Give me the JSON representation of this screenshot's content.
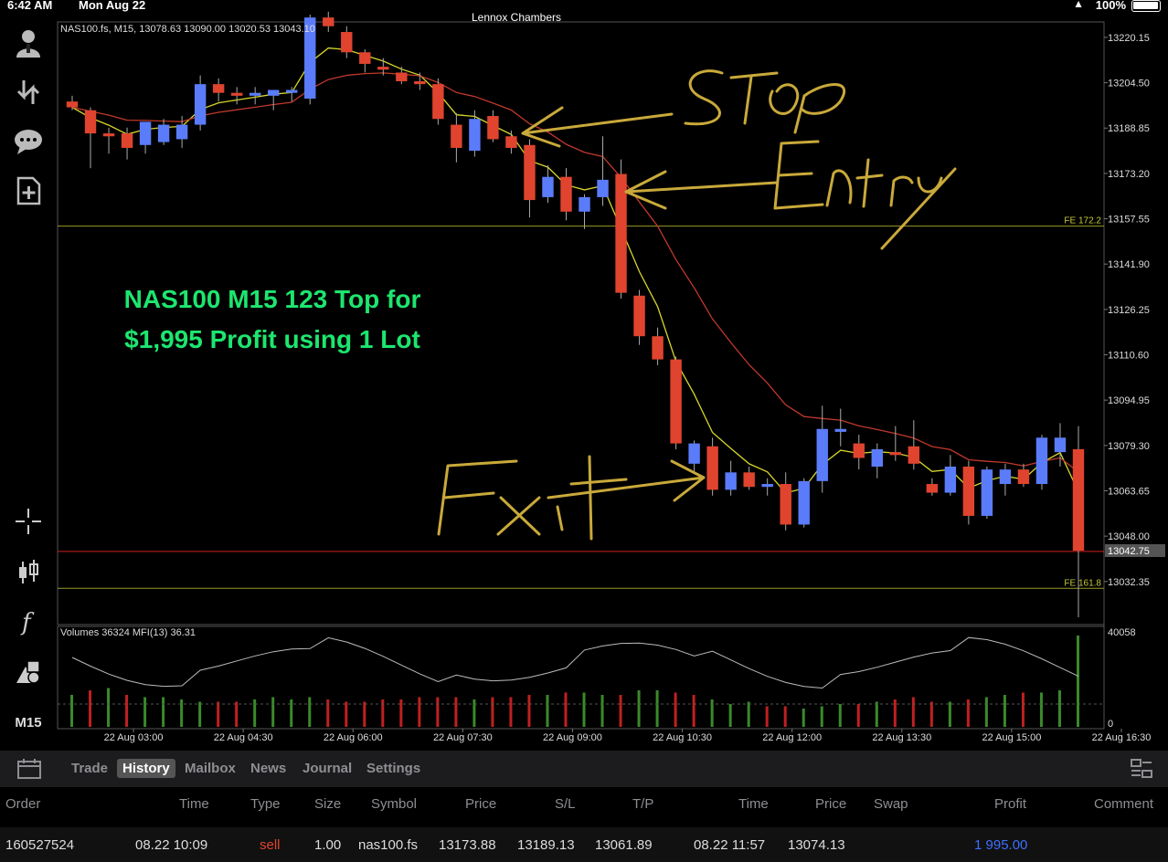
{
  "statusbar": {
    "time": "6:42 AM",
    "date": "Mon Aug 22",
    "title": "Lennox Chambers",
    "battery": "100%"
  },
  "left_toolbar": {
    "items": [
      "account-icon",
      "trade-arrows-icon",
      "chat-icon",
      "new-document-icon",
      "crosshair-icon",
      "candlestick-icon",
      "function-icon",
      "objects-icon"
    ],
    "timeframe": "M15"
  },
  "chart": {
    "header": "NAS100.fs, M15, 13078.63 13090.00 13020.53 13043.10",
    "overlay_text_line1": "NAS100 M15 123 Top for",
    "overlay_text_line2": "$1,995 Profit using 1 Lot",
    "handwritten": [
      "Stop",
      "Entry",
      "Exit"
    ],
    "fe_upper": "FE 172.2",
    "fe_lower": "FE 161.8",
    "current_price": "13042.75",
    "volume_header": "Volumes 36324 MFI(13) 36.31",
    "volume_max_label": "40058",
    "volume_zero_label": "0",
    "colors": {
      "bull": "#5b7cfa",
      "bear": "#e0442e",
      "ma_fast": "#d6d62a",
      "ma_slow": "#c0392b",
      "overlay_text": "#1de66f",
      "handwriting": "#c9a93a",
      "fe_line": "#9a9a2a",
      "price_line": "#d02020",
      "volume_up": "#3a8a2a",
      "volume_down": "#c02020"
    }
  },
  "chart_data": {
    "type": "candlestick",
    "symbol": "NAS100.fs",
    "timeframe": "M15",
    "ylim": [
      13020,
      13228
    ],
    "y_ticks": [
      "13220.15",
      "13204.50",
      "13188.85",
      "13173.20",
      "13157.55",
      "13141.90",
      "13126.25",
      "13110.60",
      "13094.95",
      "13079.30",
      "13063.65",
      "13048.00",
      "13032.35"
    ],
    "x_ticks": [
      "22 Aug 03:00",
      "22 Aug 04:30",
      "22 Aug 06:00",
      "22 Aug 07:30",
      "22 Aug 09:00",
      "22 Aug 10:30",
      "22 Aug 12:00",
      "22 Aug 13:30",
      "22 Aug 15:00",
      "22 Aug 16:30"
    ],
    "fe_levels": [
      {
        "label": "FE 172.2",
        "value": 13155
      },
      {
        "label": "FE 161.8",
        "value": 13030
      }
    ],
    "current_price": 13042.75,
    "candles": [
      {
        "o": 13198,
        "h": 13200,
        "l": 13195,
        "c": 13196
      },
      {
        "o": 13195,
        "h": 13196,
        "l": 13175,
        "c": 13187
      },
      {
        "o": 13187,
        "h": 13189,
        "l": 13180,
        "c": 13186
      },
      {
        "o": 13187,
        "h": 13189,
        "l": 13178,
        "c": 13182
      },
      {
        "o": 13183,
        "h": 13190,
        "l": 13180,
        "c": 13191
      },
      {
        "o": 13184,
        "h": 13192,
        "l": 13183,
        "c": 13190
      },
      {
        "o": 13185,
        "h": 13193,
        "l": 13182,
        "c": 13190
      },
      {
        "o": 13190,
        "h": 13207,
        "l": 13188,
        "c": 13204
      },
      {
        "o": 13204,
        "h": 13206,
        "l": 13198,
        "c": 13201
      },
      {
        "o": 13201,
        "h": 13203,
        "l": 13197,
        "c": 13200
      },
      {
        "o": 13200,
        "h": 13203,
        "l": 13197,
        "c": 13201
      },
      {
        "o": 13200,
        "h": 13202,
        "l": 13195,
        "c": 13202
      },
      {
        "o": 13201,
        "h": 13203,
        "l": 13198,
        "c": 13202
      },
      {
        "o": 13199,
        "h": 13228,
        "l": 13197,
        "c": 13227
      },
      {
        "o": 13227,
        "h": 13229,
        "l": 13222,
        "c": 13224
      },
      {
        "o": 13222,
        "h": 13224,
        "l": 13213,
        "c": 13215
      },
      {
        "o": 13215,
        "h": 13216,
        "l": 13208,
        "c": 13211
      },
      {
        "o": 13210,
        "h": 13213,
        "l": 13207,
        "c": 13209
      },
      {
        "o": 13208,
        "h": 13210,
        "l": 13204,
        "c": 13205
      },
      {
        "o": 13205,
        "h": 13208,
        "l": 13202,
        "c": 13204
      },
      {
        "o": 13204,
        "h": 13206,
        "l": 13190,
        "c": 13192
      },
      {
        "o": 13190,
        "h": 13194,
        "l": 13177,
        "c": 13182
      },
      {
        "o": 13181,
        "h": 13195,
        "l": 13179,
        "c": 13192
      },
      {
        "o": 13193,
        "h": 13195,
        "l": 13184,
        "c": 13185
      },
      {
        "o": 13186,
        "h": 13188,
        "l": 13180,
        "c": 13182
      },
      {
        "o": 13183,
        "h": 13185,
        "l": 13158,
        "c": 13164
      },
      {
        "o": 13165,
        "h": 13176,
        "l": 13163,
        "c": 13172
      },
      {
        "o": 13172,
        "h": 13175,
        "l": 13157,
        "c": 13160
      },
      {
        "o": 13160,
        "h": 13166,
        "l": 13154,
        "c": 13165
      },
      {
        "o": 13165,
        "h": 13186,
        "l": 13162,
        "c": 13171
      },
      {
        "o": 13173,
        "h": 13178,
        "l": 13130,
        "c": 13132
      },
      {
        "o": 13131,
        "h": 13133,
        "l": 13114,
        "c": 13117
      },
      {
        "o": 13117,
        "h": 13120,
        "l": 13107,
        "c": 13109
      },
      {
        "o": 13109,
        "h": 13110,
        "l": 13078,
        "c": 13080
      },
      {
        "o": 13073,
        "h": 13081,
        "l": 13070,
        "c": 13080
      },
      {
        "o": 13079,
        "h": 13082,
        "l": 13062,
        "c": 13064
      },
      {
        "o": 13064,
        "h": 13074,
        "l": 13062,
        "c": 13070
      },
      {
        "o": 13070,
        "h": 13072,
        "l": 13064,
        "c": 13065
      },
      {
        "o": 13065,
        "h": 13068,
        "l": 13062,
        "c": 13066
      },
      {
        "o": 13066,
        "h": 13070,
        "l": 13050,
        "c": 13052
      },
      {
        "o": 13052,
        "h": 13068,
        "l": 13051,
        "c": 13067
      },
      {
        "o": 13067,
        "h": 13093,
        "l": 13063,
        "c": 13085
      },
      {
        "o": 13084,
        "h": 13092,
        "l": 13079,
        "c": 13085
      },
      {
        "o": 13080,
        "h": 13083,
        "l": 13071,
        "c": 13075
      },
      {
        "o": 13072,
        "h": 13080,
        "l": 13068,
        "c": 13078
      },
      {
        "o": 13077,
        "h": 13086,
        "l": 13074,
        "c": 13076
      },
      {
        "o": 13079,
        "h": 13088,
        "l": 13071,
        "c": 13073
      },
      {
        "o": 13066,
        "h": 13068,
        "l": 13062,
        "c": 13063
      },
      {
        "o": 13063,
        "h": 13076,
        "l": 13062,
        "c": 13072
      },
      {
        "o": 13072,
        "h": 13074,
        "l": 13052,
        "c": 13055
      },
      {
        "o": 13055,
        "h": 13072,
        "l": 13054,
        "c": 13071
      },
      {
        "o": 13066,
        "h": 13073,
        "l": 13062,
        "c": 13071
      },
      {
        "o": 13071,
        "h": 13073,
        "l": 13065,
        "c": 13066
      },
      {
        "o": 13066,
        "h": 13083,
        "l": 13064,
        "c": 13082
      },
      {
        "o": 13077,
        "h": 13087,
        "l": 13072,
        "c": 13082
      },
      {
        "o": 13078,
        "h": 13086,
        "l": 13020,
        "c": 13043
      }
    ],
    "volumes": [
      14,
      16,
      17,
      14,
      13,
      13,
      12,
      11,
      11,
      11,
      12,
      13,
      12,
      13,
      12,
      11,
      11,
      12,
      12,
      13,
      13,
      13,
      12,
      13,
      13,
      14,
      14,
      15,
      15,
      14,
      14,
      16,
      16,
      15,
      14,
      12,
      10,
      11,
      9,
      9,
      8,
      9,
      10,
      10,
      11,
      12,
      13,
      11,
      11,
      12,
      13,
      14,
      15,
      15,
      16,
      40
    ],
    "volume_up_flags": [
      1,
      0,
      1,
      0,
      1,
      1,
      1,
      1,
      0,
      0,
      1,
      1,
      1,
      1,
      0,
      0,
      0,
      0,
      0,
      0,
      0,
      0,
      1,
      0,
      0,
      0,
      1,
      0,
      1,
      1,
      0,
      1,
      1,
      0,
      0,
      1,
      1,
      1,
      0,
      0,
      1,
      1,
      1,
      0,
      1,
      0,
      0,
      0,
      1,
      0,
      1,
      1,
      0,
      1,
      1,
      1
    ]
  },
  "tabs": {
    "items": [
      "Trade",
      "History",
      "Mailbox",
      "News",
      "Journal",
      "Settings"
    ],
    "active": "History"
  },
  "history_table": {
    "headers": [
      "Order",
      "Time",
      "Type",
      "Size",
      "Symbol",
      "Price",
      "S/L",
      "T/P",
      "Time",
      "Price",
      "Swap",
      "Profit",
      "Comment"
    ],
    "row": {
      "order": "160527524",
      "open_time": "08.22 10:09",
      "type": "sell",
      "size": "1.00",
      "symbol": "nas100.fs",
      "open_price": "13173.88",
      "sl": "13189.13",
      "tp": "13061.89",
      "close_time": "08.22 11:57",
      "close_price": "13074.13",
      "swap": "",
      "profit": "1 995.00",
      "comment": ""
    }
  }
}
